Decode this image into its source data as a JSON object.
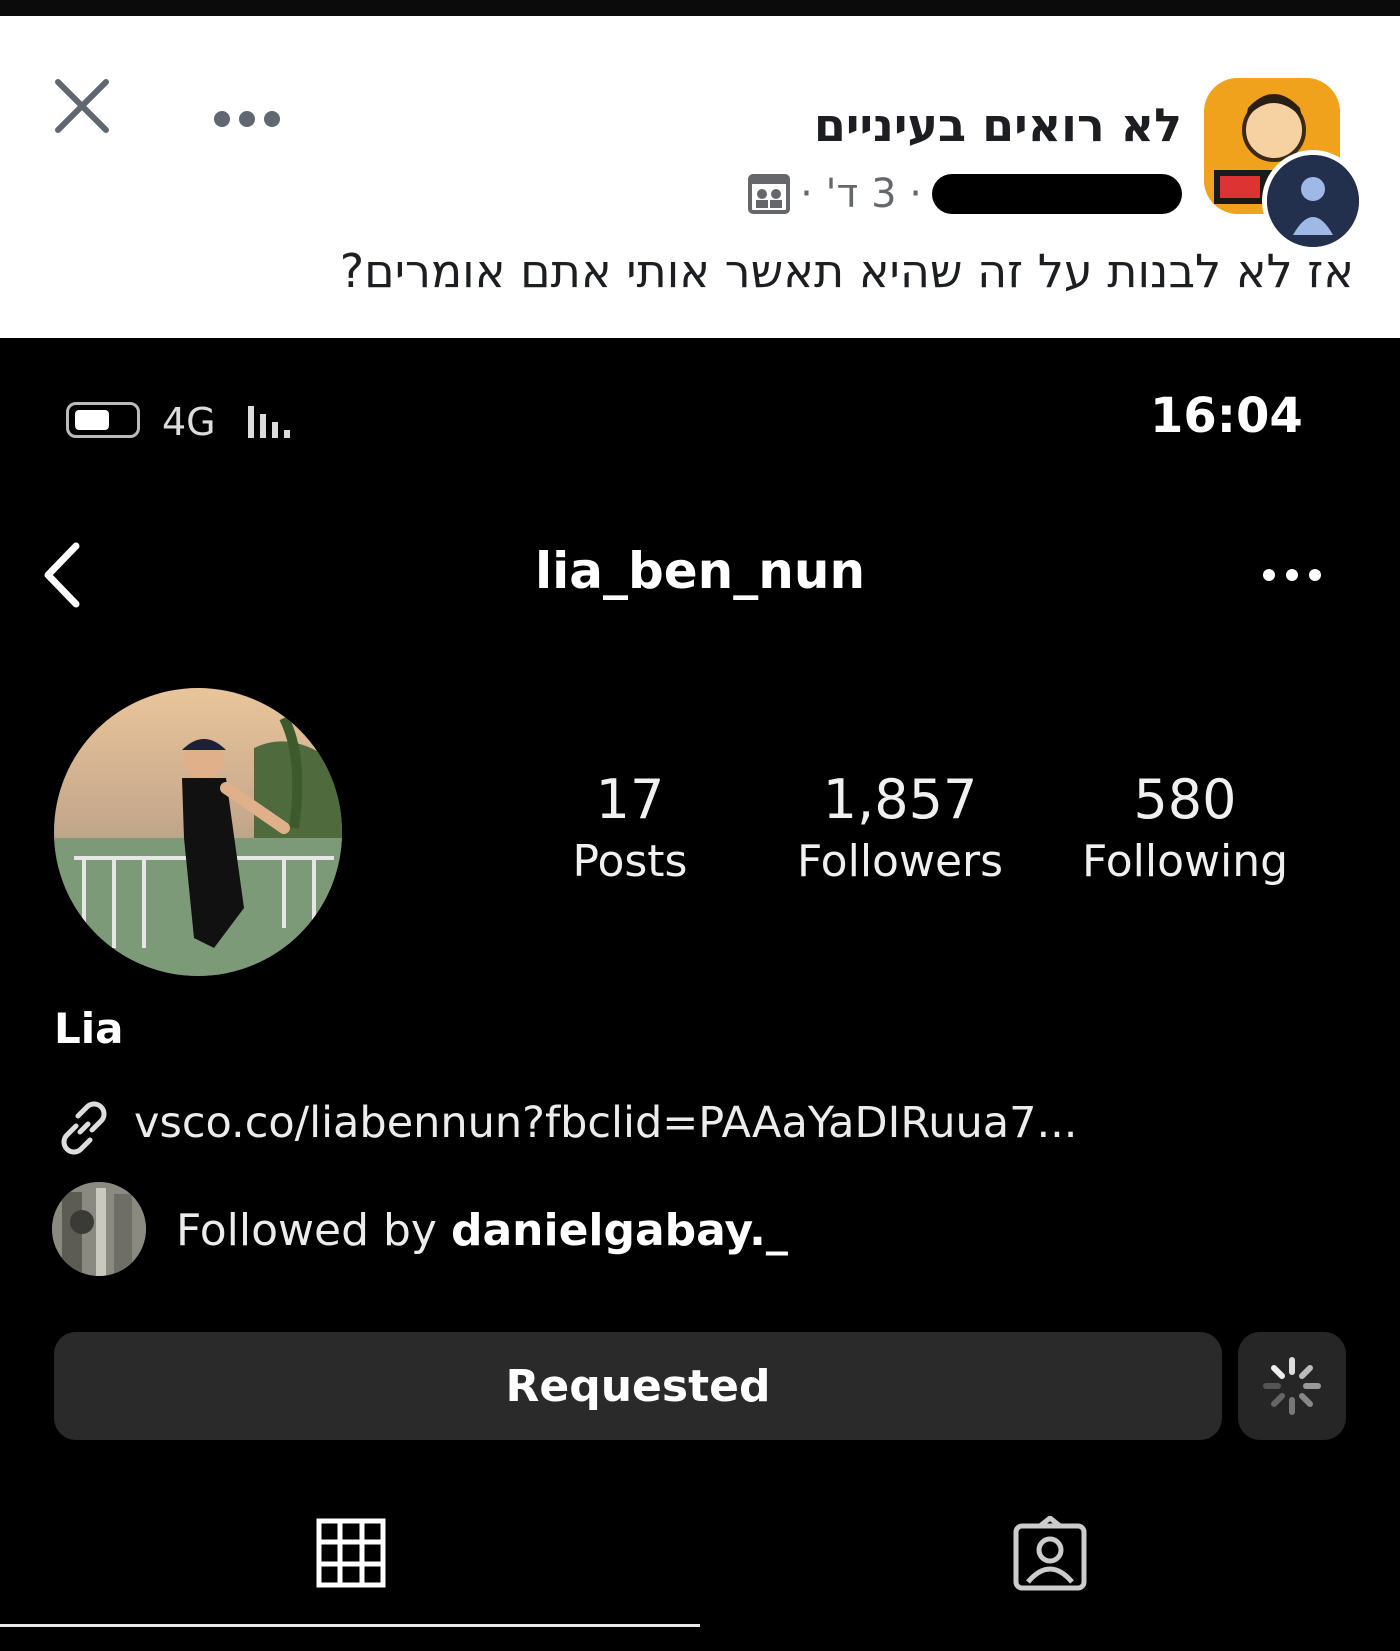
{
  "facebook": {
    "group_name": "לא רואים בעיניים",
    "time_meta": "· 3 ד' ·",
    "post_text": "אז לא לבנות על זה שהיא תאשר אותי אתם אומרים?",
    "close_icon": "close-icon",
    "more_icon": "more-horizontal-icon"
  },
  "status_bar": {
    "time": "16:04",
    "network": "4G"
  },
  "profile": {
    "username": "lia_ben_nun",
    "display_name": "Lia",
    "link": "vsco.co/liabennun?fbclid=PAAaYaDIRuua7...",
    "followed_by_prefix": "Followed by ",
    "followed_by_user": "danielgabay._",
    "stats": {
      "posts": {
        "value": "17",
        "label": "Posts"
      },
      "followers": {
        "value": "1,857",
        "label": "Followers"
      },
      "following": {
        "value": "580",
        "label": "Following"
      }
    },
    "requested_label": "Requested"
  },
  "tabs": [
    {
      "icon": "grid-icon",
      "active": true
    },
    {
      "icon": "tagged-person-icon",
      "active": false
    }
  ]
}
